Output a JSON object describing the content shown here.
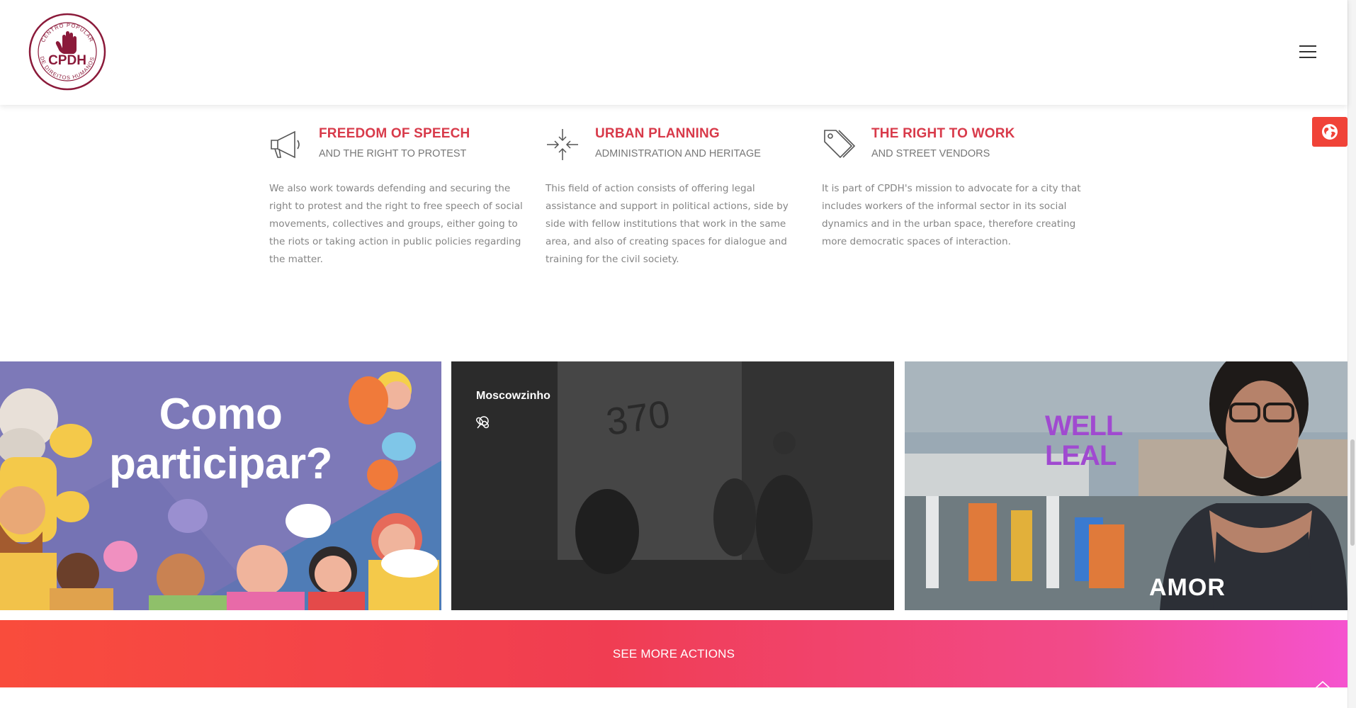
{
  "header": {
    "logo": {
      "name": "CPDH",
      "ring_text_top": "CENTRO POPULAR",
      "ring_text_bottom": "DE DIREITOS HUMANOS",
      "brand_color": "#8b1a3a"
    },
    "menu_icon": "hamburger-icon"
  },
  "side": {
    "globe_icon": "globe-icon",
    "accent": "#f04338"
  },
  "features": [
    {
      "icon": "megaphone-icon",
      "title": "FREEDOM OF SPEECH",
      "subtitle": "AND THE RIGHT TO PROTEST",
      "description": "We also work towards defending and securing the right to protest and the right to free speech of social movements, collectives and groups, either going to the riots or taking action in public policies regarding the matter."
    },
    {
      "icon": "compress-arrows-icon",
      "title": "URBAN PLANNING",
      "subtitle": "ADMINISTRATION AND HERITAGE",
      "description": "This field of action consists of offering legal assistance and support in political actions, side by side with fellow institutions that work in the same area, and also of creating spaces for dialogue and training for the civil society."
    },
    {
      "icon": "tags-icon",
      "title": "THE RIGHT TO WORK",
      "subtitle": "AND STREET VENDORS",
      "description": "It is part of CPDH's mission to advocate for a city that includes workers of the informal sector in its social dynamics and in the urban space, therefore creating more democratic spaces of interaction."
    }
  ],
  "gallery": [
    {
      "line1": "Como",
      "line2": "participar?"
    },
    {
      "title": "Moscowzinho",
      "wall_text": "370",
      "actions": [
        "search-icon",
        "link-icon"
      ]
    },
    {
      "line1": "WELL",
      "line2": "LEAL",
      "shirt_text": "AMOR"
    }
  ],
  "cta": {
    "label": "SEE MORE ACTIONS"
  },
  "colors": {
    "title_red": "#d83a4a",
    "cta_start": "#f94c3c",
    "cta_end": "#f553cf"
  }
}
